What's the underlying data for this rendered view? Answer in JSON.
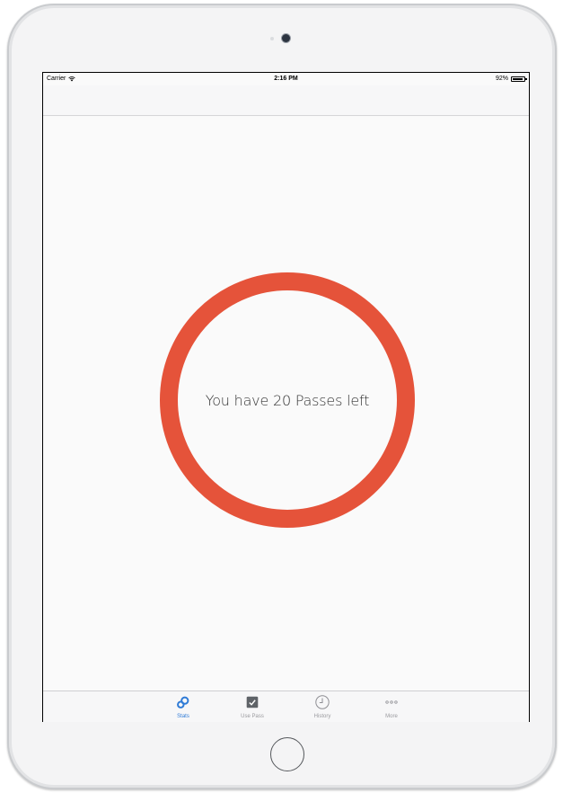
{
  "status_bar": {
    "carrier": "Carrier",
    "time": "2:16 PM",
    "battery": "92%",
    "battery_level": 0.92
  },
  "main": {
    "passes_text": "You have 20 Passes left",
    "ring_color": "#e5533a"
  },
  "tab_bar": {
    "active_color": "#2f7bd6",
    "tabs": [
      {
        "label": "Stats",
        "icon": "stats-icon",
        "active": true
      },
      {
        "label": "Use Pass",
        "icon": "checkbox-icon",
        "active": false
      },
      {
        "label": "History",
        "icon": "clock-icon",
        "active": false
      },
      {
        "label": "More",
        "icon": "more-icon",
        "active": false
      }
    ]
  }
}
